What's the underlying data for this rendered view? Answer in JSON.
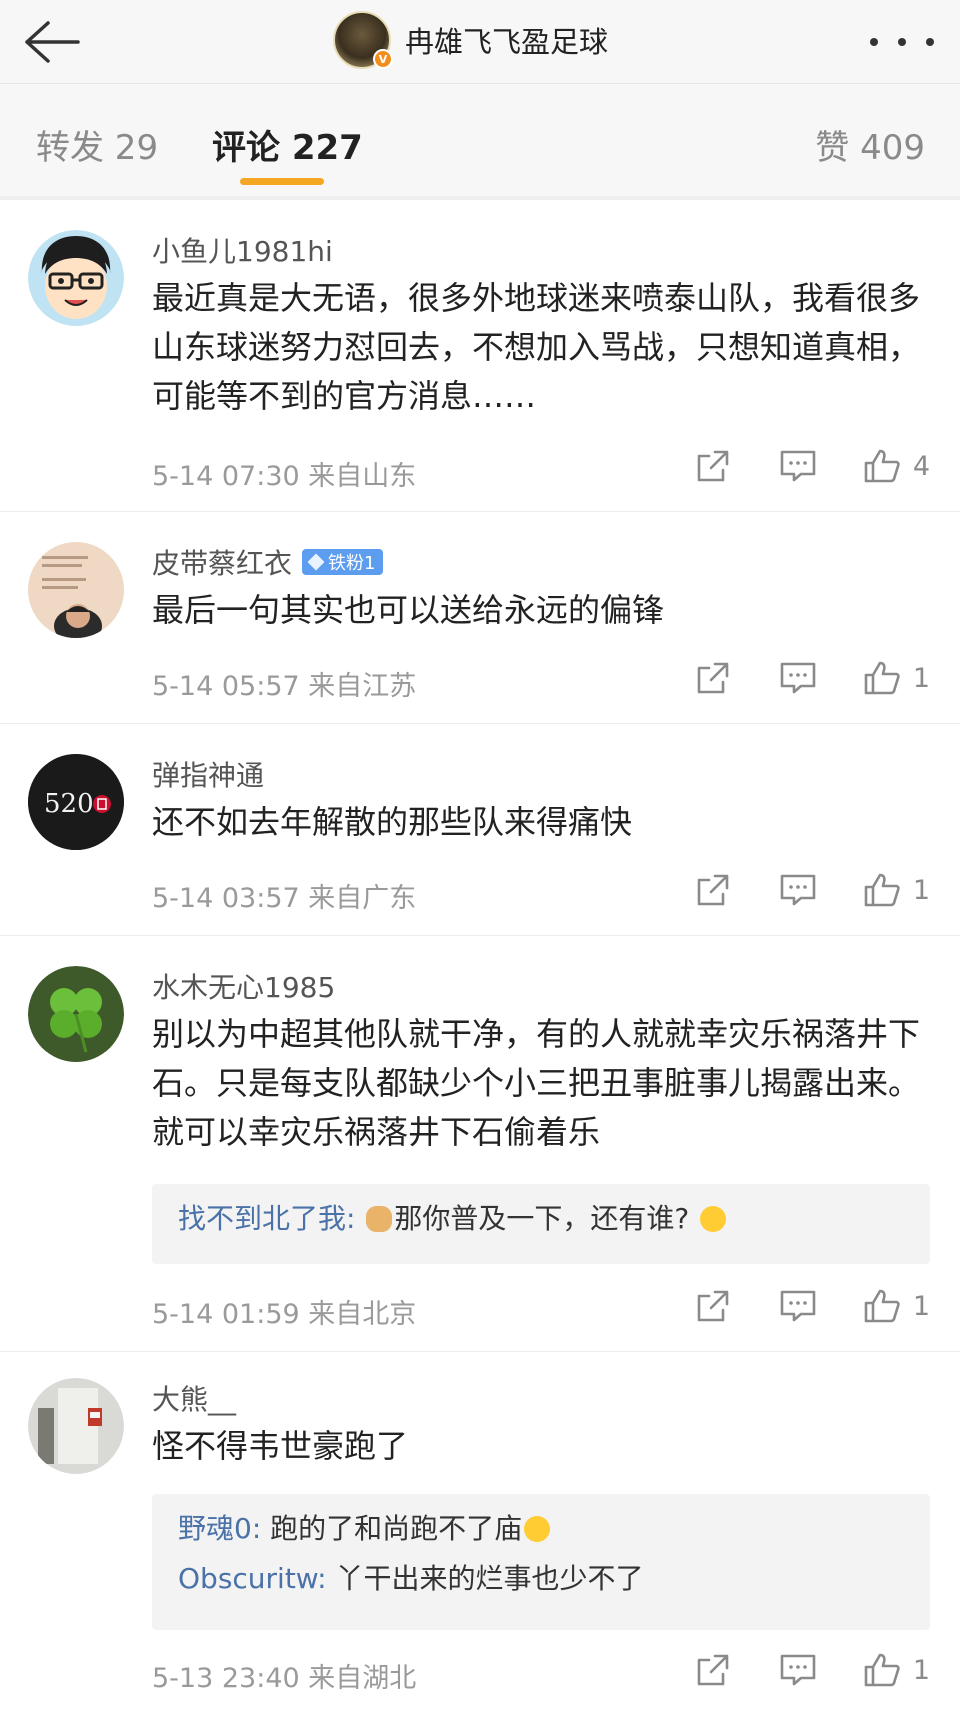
{
  "header": {
    "title": "冉雄飞飞盈足球",
    "verified_badge": "V",
    "icons": {
      "back": "back-arrow-icon",
      "more": "more-dots-icon"
    }
  },
  "tabs": [
    {
      "label": "转发 29"
    },
    {
      "label": "评论 227",
      "active": true
    },
    {
      "label": "赞 409"
    }
  ],
  "colors": {
    "accent": "#f5a623",
    "reply_name": "#4a72a8",
    "fan_badge": "#5d9df0",
    "muted": "#9a9a9a"
  },
  "comments": [
    {
      "username": "小鱼儿1981hi",
      "text": "最近真是大无语，很多外地球迷来喷泰山队，我看很多山东球迷努力怼回去，不想加入骂战，只想知道真相，可能等不到的官方消息……",
      "meta": "5-14 07:30  来自山东",
      "likes": "4"
    },
    {
      "username": "皮带蔡红衣",
      "badge": "铁粉1",
      "text": "最后一句其实也可以送给永远的偏锋",
      "meta": "5-14 05:57  来自江苏",
      "likes": "1"
    },
    {
      "username": "弹指神通",
      "avatar_text": "520",
      "text": "还不如去年解散的那些队来得痛快",
      "meta": "5-14 03:57  来自广东",
      "likes": "1"
    },
    {
      "username": "水木无心1985",
      "text": "别以为中超其他队就干净，有的人就就幸灾乐祸落井下石。只是每支队都缺少个小三把丑事脏事儿揭露出来。就可以幸灾乐祸落井下石偷着乐",
      "replies": [
        {
          "name": "找不到北了我:",
          "text": "那你普及一下，还有谁?"
        }
      ],
      "meta": "5-14 01:59  来自北京",
      "likes": "1"
    },
    {
      "username": "大熊__",
      "text": "怪不得韦世豪跑了",
      "replies": [
        {
          "name": "野魂0:",
          "text": "跑的了和尚跑不了庙"
        },
        {
          "name": "Obscuritw:",
          "text": "丫干出来的烂事也少不了"
        }
      ],
      "meta": "5-13 23:40  来自湖北",
      "likes": "1"
    }
  ]
}
